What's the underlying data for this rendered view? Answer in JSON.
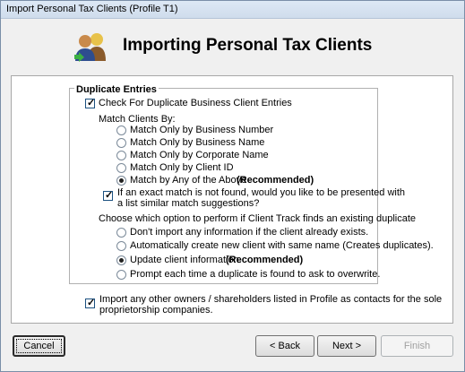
{
  "window": {
    "title": "Import Personal Tax Clients (Profile T1)"
  },
  "header": {
    "title": "Importing Personal Tax Clients",
    "icon": "users-icon"
  },
  "duplicate_entries": {
    "legend": "Duplicate Entries",
    "check_duplicates_label": "Check For Duplicate Business Client Entries",
    "check_duplicates_checked": true,
    "match_by_label": "Match Clients By:",
    "match_options": [
      {
        "label": "Match Only by Business Number",
        "selected": false
      },
      {
        "label": "Match Only by Business Name",
        "selected": false
      },
      {
        "label": "Match Only by Corporate Name",
        "selected": false
      },
      {
        "label": "Match Only by Client ID",
        "selected": false
      },
      {
        "label": "Match by Any of the Above",
        "selected": true,
        "note": "(Recommended)"
      }
    ],
    "suggest_label_line1": "If an exact match is not found, would you like to be presented with",
    "suggest_label_line2": "a list similar match suggestions?",
    "suggest_checked": true,
    "existing_label": "Choose which option to perform if Client Track finds an existing duplicate",
    "existing_options": [
      {
        "label": "Don't import any information if the client already exists.",
        "selected": false
      },
      {
        "label": "Automatically create new client with same name (Creates duplicates).",
        "selected": false
      },
      {
        "label": "Update client information.",
        "selected": true,
        "note": "(Recommended)"
      },
      {
        "label": "Prompt each time a duplicate is found to ask to overwrite.",
        "selected": false
      }
    ]
  },
  "import_owners": {
    "label_line1": "Import any other owners / shareholders listed in Profile as contacts for the sole",
    "label_line2": "proprietorship companies.",
    "checked": true
  },
  "buttons": {
    "cancel": "Cancel",
    "back": "< Back",
    "next": "Next >",
    "finish": "Finish"
  }
}
